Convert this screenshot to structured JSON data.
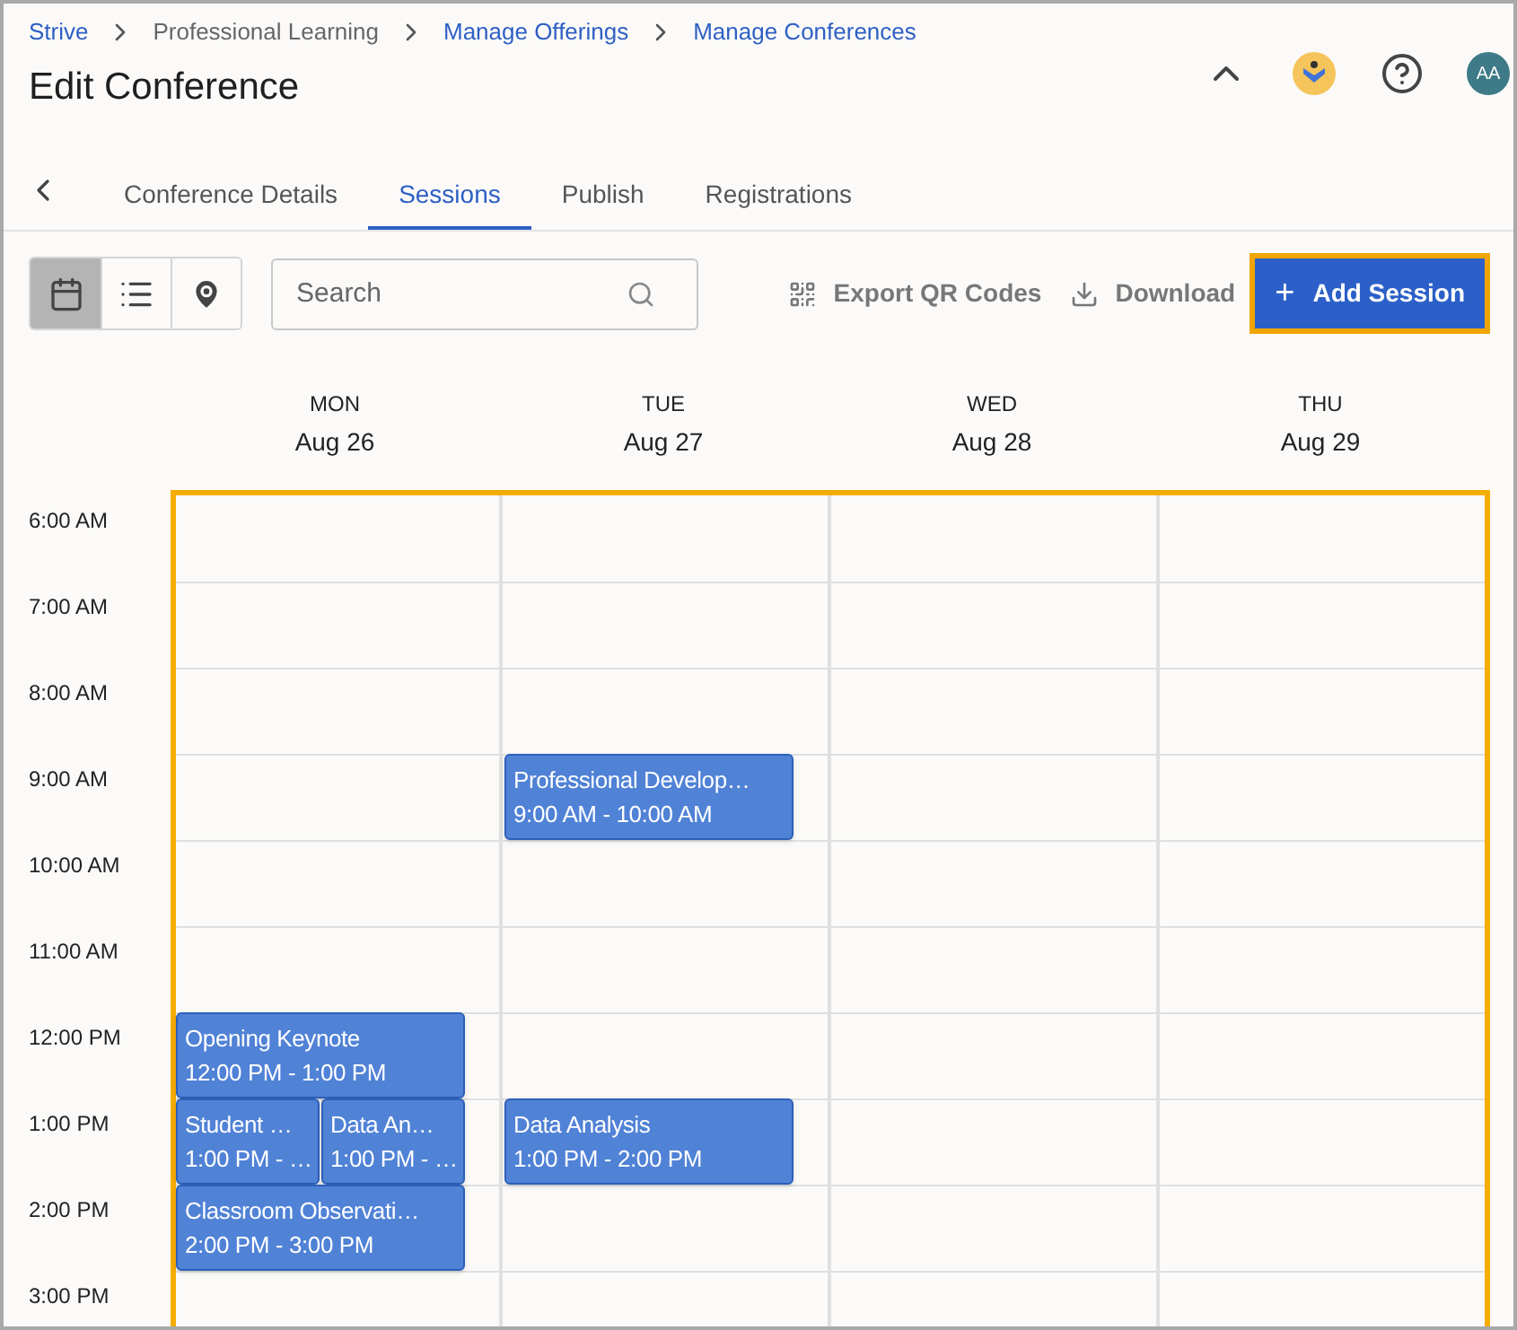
{
  "breadcrumb": [
    {
      "label": "Strive",
      "link": true
    },
    {
      "label": "Professional Learning",
      "link": false
    },
    {
      "label": "Manage Offerings",
      "link": true
    },
    {
      "label": "Manage Conferences",
      "link": true
    }
  ],
  "title": "Edit Conference",
  "avatar": "AA",
  "tabs": [
    {
      "label": "Conference Details",
      "selected": false
    },
    {
      "label": "Sessions",
      "selected": true
    },
    {
      "label": "Publish",
      "selected": false
    },
    {
      "label": "Registrations",
      "selected": false
    }
  ],
  "views": [
    {
      "kind": "calendar",
      "selected": true
    },
    {
      "kind": "list",
      "selected": false
    },
    {
      "kind": "map",
      "selected": false
    }
  ],
  "search": {
    "placeholder": "Search"
  },
  "actions": [
    {
      "kind": "qr",
      "label": "Export QR Codes"
    },
    {
      "kind": "download",
      "label": "Download"
    }
  ],
  "add_button": {
    "icon": "+",
    "label": "Add Session"
  },
  "days": [
    {
      "weekday": "MON",
      "date": "Aug 26"
    },
    {
      "weekday": "TUE",
      "date": "Aug 27"
    },
    {
      "weekday": "WED",
      "date": "Aug 28"
    },
    {
      "weekday": "THU",
      "date": "Aug 29"
    }
  ],
  "hours": [
    {
      "label": "6:00 AM",
      "cells": [
        [],
        [],
        [],
        []
      ]
    },
    {
      "label": "7:00 AM",
      "cells": [
        [],
        [],
        [],
        []
      ]
    },
    {
      "label": "8:00 AM",
      "cells": [
        [],
        [],
        [],
        []
      ]
    },
    {
      "label": "9:00 AM",
      "cells": [
        [],
        [
          {
            "title": "Professional Develop…",
            "time": "9:00 AM - 10:00 AM"
          }
        ],
        [],
        []
      ]
    },
    {
      "label": "10:00 AM",
      "cells": [
        [],
        [],
        [],
        []
      ]
    },
    {
      "label": "11:00 AM",
      "cells": [
        [],
        [],
        [],
        []
      ]
    },
    {
      "label": "12:00 PM",
      "cells": [
        [
          {
            "title": "Opening Keynote",
            "time": "12:00 PM - 1:00 PM"
          }
        ],
        [],
        [],
        []
      ]
    },
    {
      "label": "1:00 PM",
      "cells": [
        [
          {
            "title": "Student …",
            "time": "1:00 PM - …"
          },
          {
            "title": "Data An…",
            "time": "1:00 PM - …"
          }
        ],
        [
          {
            "title": "Data Analysis",
            "time": "1:00 PM - 2:00 PM"
          }
        ],
        [],
        []
      ]
    },
    {
      "label": "2:00 PM",
      "cells": [
        [
          {
            "title": "Classroom Observati…",
            "time": "2:00 PM - 3:00 PM"
          }
        ],
        [],
        [],
        []
      ]
    },
    {
      "label": "3:00 PM",
      "cells": [
        [],
        [],
        [],
        []
      ]
    }
  ]
}
